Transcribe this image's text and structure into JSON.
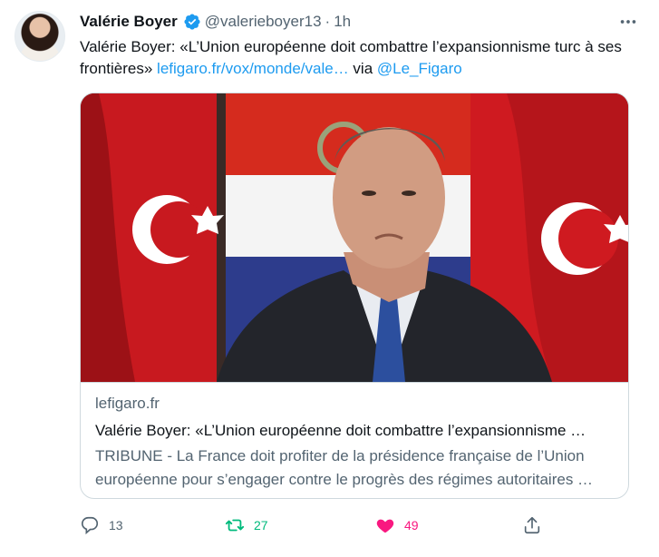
{
  "tweet": {
    "author": {
      "display_name": "Valérie Boyer",
      "handle": "@valerieboyer13",
      "separator": "·",
      "time": "1h",
      "verified": true
    },
    "text_before_link": "Valérie Boyer: «L’Union européenne doit combattre l’expansionnisme turc à ses frontières» ",
    "link_text": "lefigaro.fr/vox/monde/vale…",
    "via_text": " via ",
    "mention": "@Le_Figaro"
  },
  "card": {
    "domain": "lefigaro.fr",
    "title": "Valérie Boyer: «L’Union européenne doit combattre l’expansionnisme …",
    "description": "TRIBUNE - La France doit profiter de la présidence française de l’Union européenne pour s’engager contre le progrès des régimes autoritaires …"
  },
  "actions": {
    "reply_count": "13",
    "retweet_count": "27",
    "like_count": "49",
    "liked": true,
    "retweeted": true
  },
  "colors": {
    "accent": "#1d9bf0",
    "retweet": "#00ba7c",
    "like": "#f91880",
    "secondary_text": "#536471"
  }
}
